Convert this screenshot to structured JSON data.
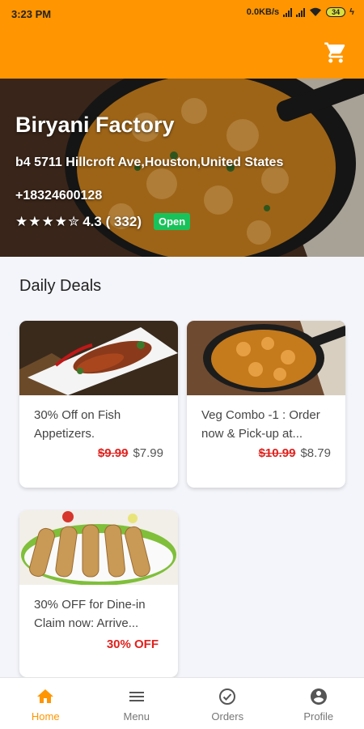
{
  "status_bar": {
    "time": "3:23 PM",
    "network_speed": "0.0KB/s",
    "battery": "34"
  },
  "header": {
    "cart_icon": "cart-icon",
    "background_color": "#ff9500"
  },
  "restaurant": {
    "name": "Biryani Factory",
    "address": "b4 5711 Hillcroft Ave,Houston,United States",
    "phone": "+18324600128",
    "stars": "★★★★✮",
    "rating": "4.3 ( 332)",
    "status": "Open"
  },
  "section_title": "Daily Deals",
  "deals": [
    {
      "title": "30% Off on Fish Appetizers.",
      "old_price": "$9.99",
      "new_price": "$7.99"
    },
    {
      "title": "Veg Combo -1 : Order now & Pick-up at...",
      "old_price": "$10.99",
      "new_price": "$8.79"
    },
    {
      "title": "30% OFF for Dine-in Claim now: Arrive...",
      "offer": "30% OFF"
    }
  ],
  "bottom_nav": [
    {
      "label": "Home",
      "icon": "home-icon",
      "active": true
    },
    {
      "label": "Menu",
      "icon": "menu-icon"
    },
    {
      "label": "Orders",
      "icon": "orders-check-icon"
    },
    {
      "label": "Profile",
      "icon": "profile-icon"
    }
  ],
  "colors": {
    "accent": "#ff9500",
    "open_badge": "#19c25a",
    "price_red": "#e0211d"
  }
}
